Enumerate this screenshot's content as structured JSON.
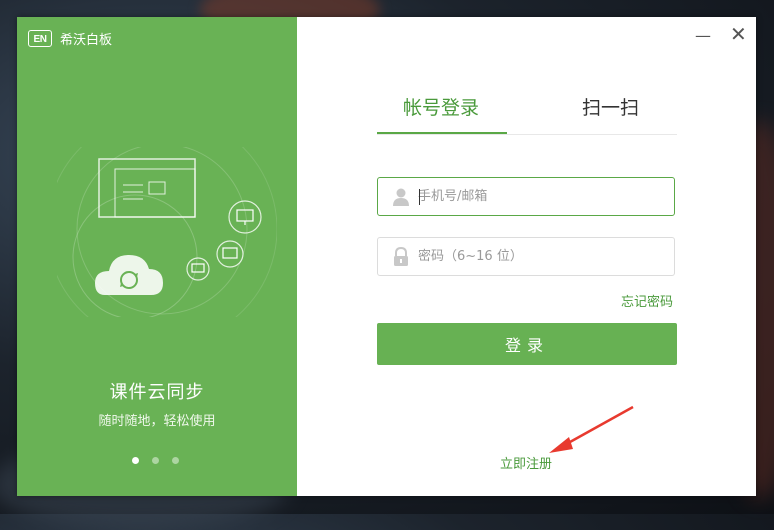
{
  "app": {
    "logo_text": "EN",
    "name": "希沃白板"
  },
  "promo": {
    "slogan": "课件云同步",
    "subslogan": "随时随地，轻松使用",
    "carousel": {
      "count": 3,
      "active_index": 0
    }
  },
  "window_controls": {
    "minimize": "—",
    "close": "✕"
  },
  "tabs": [
    {
      "label": "帐号登录",
      "active": true
    },
    {
      "label": "扫一扫",
      "active": false
    }
  ],
  "form": {
    "username_placeholder": "手机号/邮箱",
    "password_placeholder": "密码（6~16 位）",
    "forgot_label": "忘记密码",
    "login_label": "登录"
  },
  "register_label": "立即注册",
  "colors": {
    "brand_green": "#69b255",
    "annotation_arrow": "#e83a2f"
  },
  "icons": [
    "user-icon",
    "lock-icon",
    "cloud-sync-icon",
    "monitor-icon"
  ]
}
